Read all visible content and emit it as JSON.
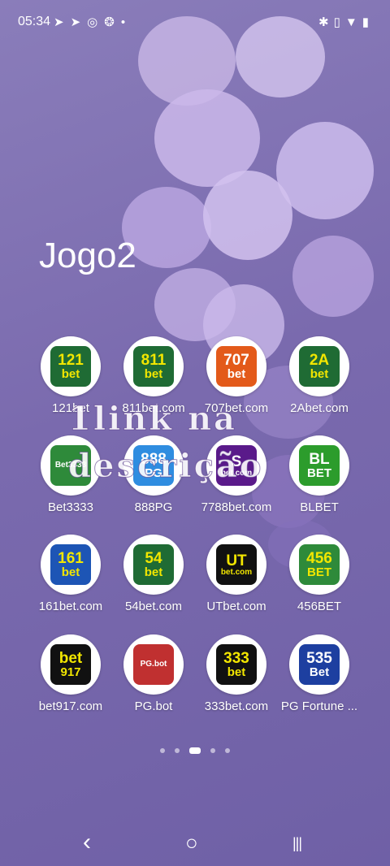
{
  "status_bar": {
    "time": "05:34",
    "left_icons": [
      "telegram-icon",
      "telegram-icon",
      "location-icon",
      "app-icon",
      "dot-icon"
    ],
    "right_icons": [
      "bluetooth-icon",
      "vibrate-icon",
      "wifi-icon",
      "battery-icon"
    ]
  },
  "folder": {
    "title": "Jogo2"
  },
  "overlay_text": {
    "line1": "1link na",
    "line2": "descrição"
  },
  "apps": [
    {
      "label": "121bet",
      "logo_top": "121",
      "logo_bottom": "bet",
      "bg": "#1f6b34",
      "fg": "#f2e600"
    },
    {
      "label": "811bet.com",
      "logo_top": "811",
      "logo_bottom": "bet",
      "bg": "#1f6b34",
      "fg": "#f2e600"
    },
    {
      "label": "707bet.com",
      "logo_top": "707",
      "logo_bottom": "bet",
      "bg": "#e35a1a",
      "fg": "#ffffff"
    },
    {
      "label": "2Abet.com",
      "logo_top": "2A",
      "logo_bottom": "bet",
      "bg": "#1f6b34",
      "fg": "#f2e600"
    },
    {
      "label": "Bet3333",
      "logo_top": "",
      "logo_bottom": "Bet3333",
      "bg": "#2e8a3a",
      "fg": "#ffffff"
    },
    {
      "label": "888PG",
      "logo_top": "888",
      "logo_bottom": "PG",
      "bg": "#2f8de0",
      "fg": "#ffffff"
    },
    {
      "label": "7788bet.com",
      "logo_top": "S",
      "logo_bottom": "bet.com",
      "bg": "#5a1a8a",
      "fg": "#ffffff"
    },
    {
      "label": "BLBET",
      "logo_top": "BL",
      "logo_bottom": "BET",
      "bg": "#2c9c2c",
      "fg": "#ffffff"
    },
    {
      "label": "161bet.com",
      "logo_top": "161",
      "logo_bottom": "bet",
      "bg": "#1d55b5",
      "fg": "#f2e600"
    },
    {
      "label": "54bet.com",
      "logo_top": "54",
      "logo_bottom": "bet",
      "bg": "#1f6b34",
      "fg": "#f2e600"
    },
    {
      "label": "UTbet.com",
      "logo_top": "UT",
      "logo_bottom": "bet.com",
      "bg": "#111111",
      "fg": "#f2e600"
    },
    {
      "label": "456BET",
      "logo_top": "456",
      "logo_bottom": "BET",
      "bg": "#2e8a3a",
      "fg": "#f2e600"
    },
    {
      "label": "bet917.com",
      "logo_top": "bet",
      "logo_bottom": "917",
      "bg": "#111111",
      "fg": "#f2e600"
    },
    {
      "label": "PG.bot",
      "logo_top": "",
      "logo_bottom": "PG.bot",
      "bg": "#c03030",
      "fg": "#ffffff"
    },
    {
      "label": "333bet.com",
      "logo_top": "333",
      "logo_bottom": "bet",
      "bg": "#111111",
      "fg": "#f2e600"
    },
    {
      "label": "PG Fortune ...",
      "logo_top": "535",
      "logo_bottom": "Bet",
      "bg": "#1d3fa0",
      "fg": "#ffffff"
    }
  ],
  "page_indicator": {
    "count": 5,
    "active_index": 2
  },
  "navbar": {
    "back": "‹",
    "home": "○",
    "recents": "|||"
  }
}
